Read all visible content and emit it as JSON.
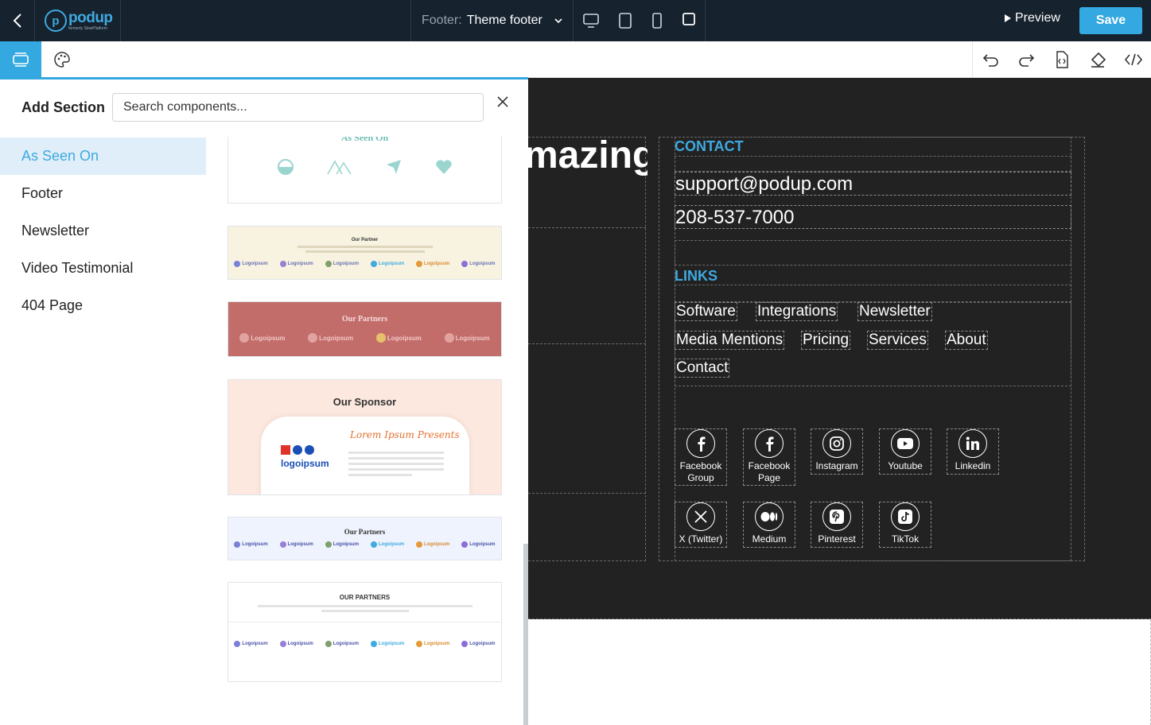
{
  "topbar": {
    "logo_word": "podup",
    "logo_sub": "formerly SlowPlatform",
    "page_label": "Footer:",
    "page_value": "Theme footer",
    "preview_label": "Preview",
    "save_label": "Save"
  },
  "panel": {
    "title": "Add Section",
    "search_placeholder": "Search components...",
    "categories": [
      {
        "label": "As Seen On"
      },
      {
        "label": "Footer"
      },
      {
        "label": "Newsletter"
      },
      {
        "label": "Video Testimonial"
      },
      {
        "label": "404 Page"
      }
    ],
    "thumbnails": {
      "t1_title": "As Seen On",
      "t2_title": "Our Partner",
      "t3_title": "Our Partners",
      "t4_title": "Our Sponsor",
      "t4_brand": "logoipsum",
      "t4_script": "Lorem Ipsum Presents",
      "t5_title": "Our Partners",
      "t6_title": "OUR PARTNERS",
      "logo_word": "Logoipsum"
    }
  },
  "canvas": {
    "hero_fragment": "mazing",
    "contact_heading": "CONTACT",
    "email": "support@podup.com",
    "phone": "208-537-7000",
    "links_heading": "LINKS",
    "links": [
      "Software",
      "Integrations",
      "Newsletter",
      "Media Mentions",
      "Pricing",
      "Services",
      "About",
      "Contact"
    ],
    "socials": [
      {
        "label": "Facebook Group",
        "icon": "facebook-icon"
      },
      {
        "label": "Facebook Page",
        "icon": "facebook-icon"
      },
      {
        "label": "Instagram",
        "icon": "instagram-icon"
      },
      {
        "label": "Youtube",
        "icon": "youtube-icon"
      },
      {
        "label": "Linkedin",
        "icon": "linkedin-icon"
      },
      {
        "label": "X (Twitter)",
        "icon": "x-icon"
      },
      {
        "label": "Medium",
        "icon": "medium-icon"
      },
      {
        "label": "Pinterest",
        "icon": "pinterest-icon"
      },
      {
        "label": "TikTok",
        "icon": "tiktok-icon"
      }
    ]
  },
  "colors": {
    "accent": "#34a8e0",
    "topbar_bg": "#16222e",
    "canvas_bg": "#222222"
  }
}
